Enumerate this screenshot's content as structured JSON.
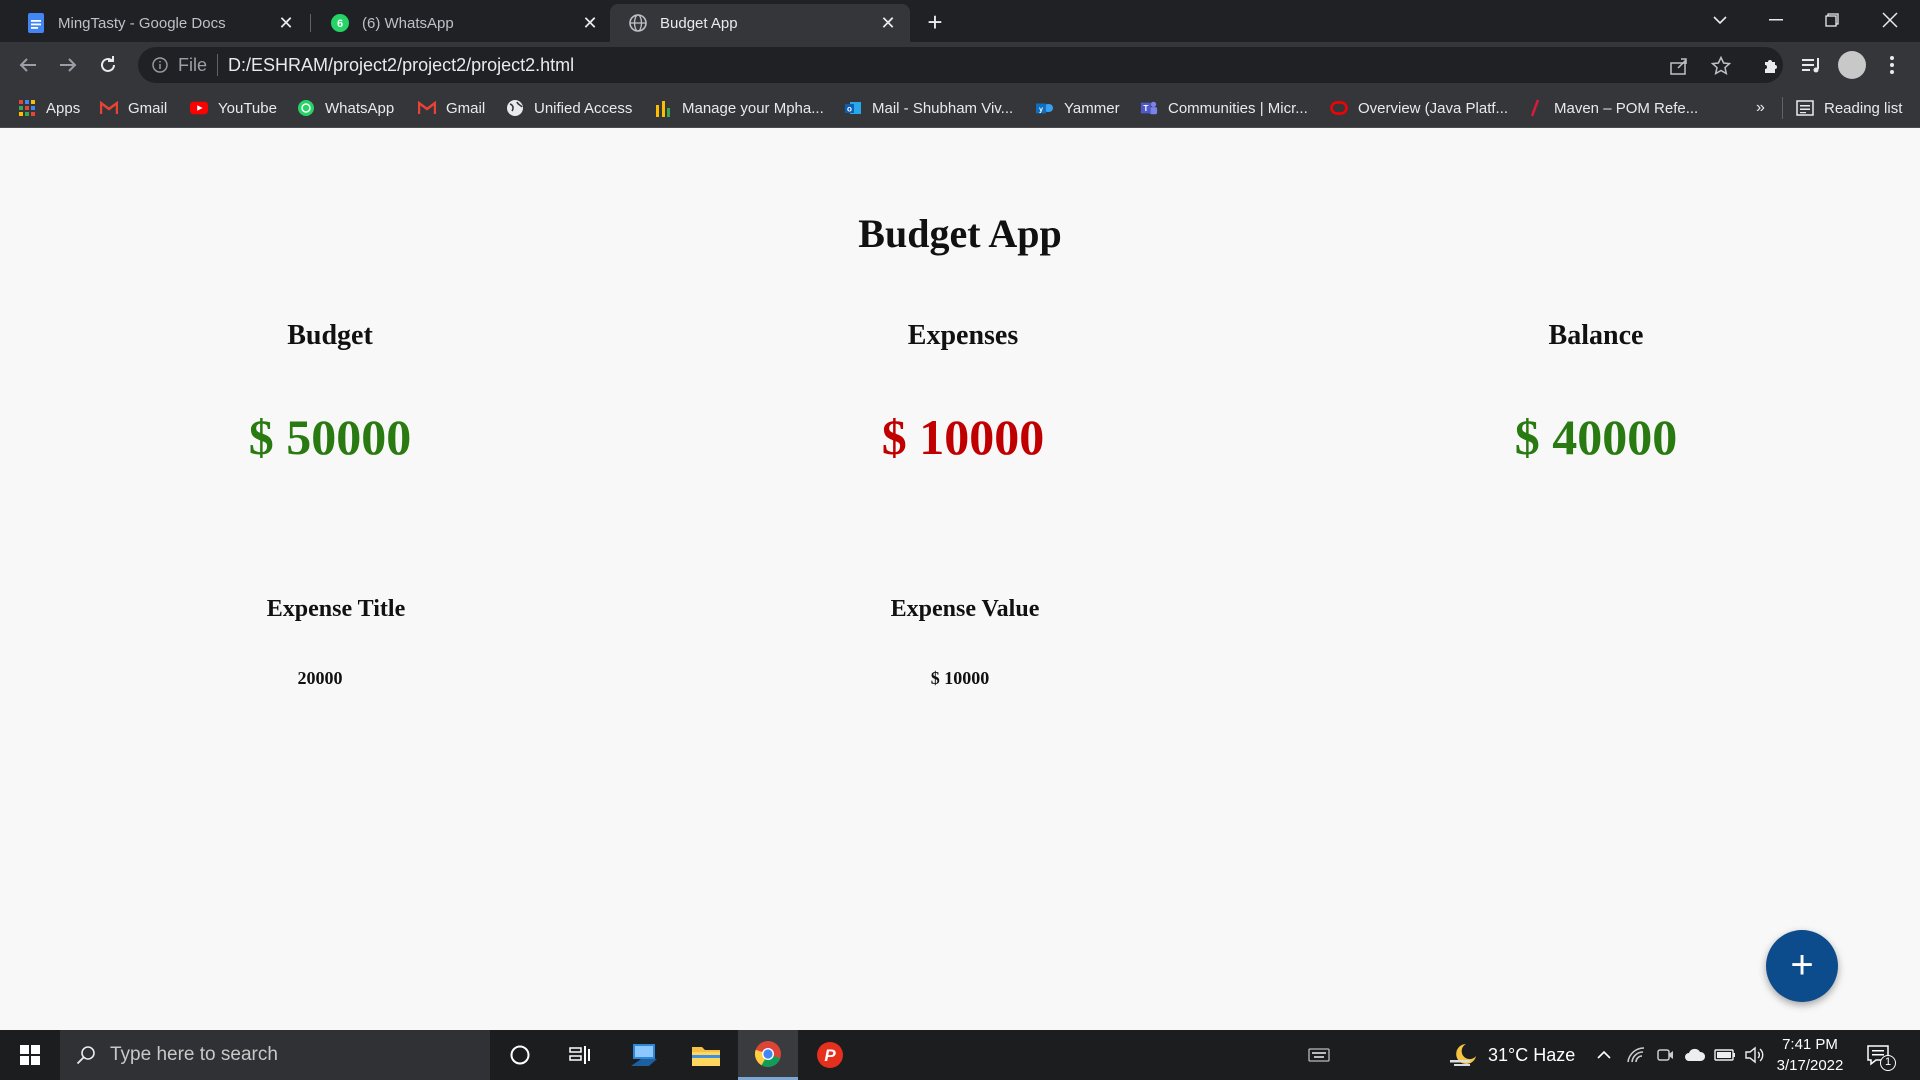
{
  "browser": {
    "tabs": [
      {
        "title": "MingTasty - Google Docs",
        "icon": "google-docs-icon"
      },
      {
        "title": "(6) WhatsApp",
        "icon": "whatsapp-icon",
        "badge": "6"
      },
      {
        "title": "Budget App",
        "icon": "globe-icon"
      }
    ],
    "address": {
      "scheme_label": "File",
      "url": "D:/ESHRAM/project2/project2/project2.html"
    },
    "bookmarks": [
      {
        "label": "Apps",
        "icon": "apps-grid-icon"
      },
      {
        "label": "Gmail",
        "icon": "gmail-icon"
      },
      {
        "label": "YouTube",
        "icon": "youtube-icon"
      },
      {
        "label": "WhatsApp",
        "icon": "whatsapp-icon"
      },
      {
        "label": "Gmail",
        "icon": "gmail-icon"
      },
      {
        "label": "Unified Access",
        "icon": "globe-icon"
      },
      {
        "label": "Manage your Mpha...",
        "icon": "chart-icon"
      },
      {
        "label": "Mail - Shubham Viv...",
        "icon": "outlook-icon"
      },
      {
        "label": "Yammer",
        "icon": "yammer-icon"
      },
      {
        "label": "Communities | Micr...",
        "icon": "teams-icon"
      },
      {
        "label": "Overview (Java Platf...",
        "icon": "oracle-icon"
      },
      {
        "label": "Maven – POM Refe...",
        "icon": "maven-icon"
      }
    ],
    "overflow_label": "»",
    "reading_list_label": "Reading list"
  },
  "app": {
    "title": "Budget App",
    "budget": {
      "label": "Budget",
      "value": "$ 50000"
    },
    "expenses": {
      "label": "Expenses",
      "value": "$ 10000"
    },
    "balance": {
      "label": "Balance",
      "value": "$ 40000"
    },
    "expense_table": {
      "headers": [
        "Expense Title",
        "Expense Value"
      ],
      "rows": [
        [
          "20000",
          "$ 10000"
        ]
      ]
    },
    "fab_label": "+"
  },
  "taskbar": {
    "search_placeholder": "Type here to search",
    "weather": "31°C  Haze",
    "time": "7:41 PM",
    "date": "3/17/2022",
    "notification_count": "1"
  },
  "colors": {
    "positive": "#2a7a12",
    "negative": "#c00000",
    "fab": "#0c4c8c"
  }
}
